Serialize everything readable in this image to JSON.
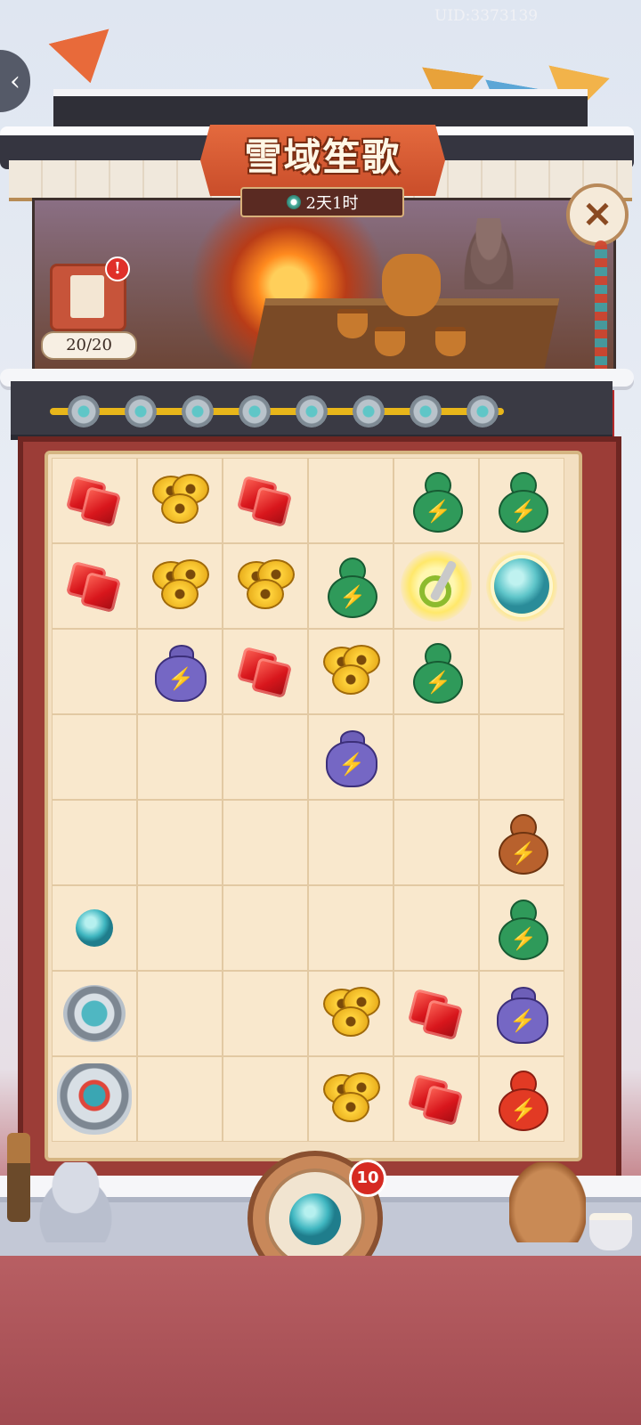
{
  "header": {
    "uid": "UID:3373139",
    "title": "雪域笙歌",
    "timer": "2天1时"
  },
  "counter": {
    "value": "20/20",
    "badge": "!"
  },
  "progress": {
    "milestones": [
      "turquoise-cluster",
      "ring-brooch",
      "bangle",
      "ornate-pendant",
      "gem-necklace",
      "silver-amulet",
      "fan-pendant",
      "crown-ornament"
    ]
  },
  "board": {
    "rows": 8,
    "cols": 6,
    "cells": [
      [
        "red-gem",
        "gold-coins",
        "red-gem",
        "",
        "green-gourd",
        "green-gourd"
      ],
      [
        "red-gem",
        "gold-coins",
        "gold-coins",
        "green-gourd",
        "scissors-glow",
        "wind-orb-glow"
      ],
      [
        "",
        "purple-sack",
        "red-gem",
        "gold-coins",
        "green-gourd",
        ""
      ],
      [
        "",
        "",
        "",
        "purple-sack",
        "",
        ""
      ],
      [
        "",
        "",
        "",
        "",
        "",
        "brown-gourd"
      ],
      [
        "turquoise",
        "",
        "",
        "",
        "",
        "green-gourd"
      ],
      [
        "silver-brooch",
        "",
        "",
        "gold-coins",
        "red-gem",
        "purple-sack"
      ],
      [
        "silver-amulet",
        "",
        "",
        "gold-coins",
        "red-gem",
        "red-gourd"
      ]
    ]
  },
  "spawner": {
    "count": "10",
    "item": "turquoise"
  },
  "buttons": {
    "back": "‹",
    "close": "✕"
  },
  "colors": {
    "accent": "#c94d2a",
    "board": "#f9e8cd",
    "frame": "#9c3d37"
  }
}
